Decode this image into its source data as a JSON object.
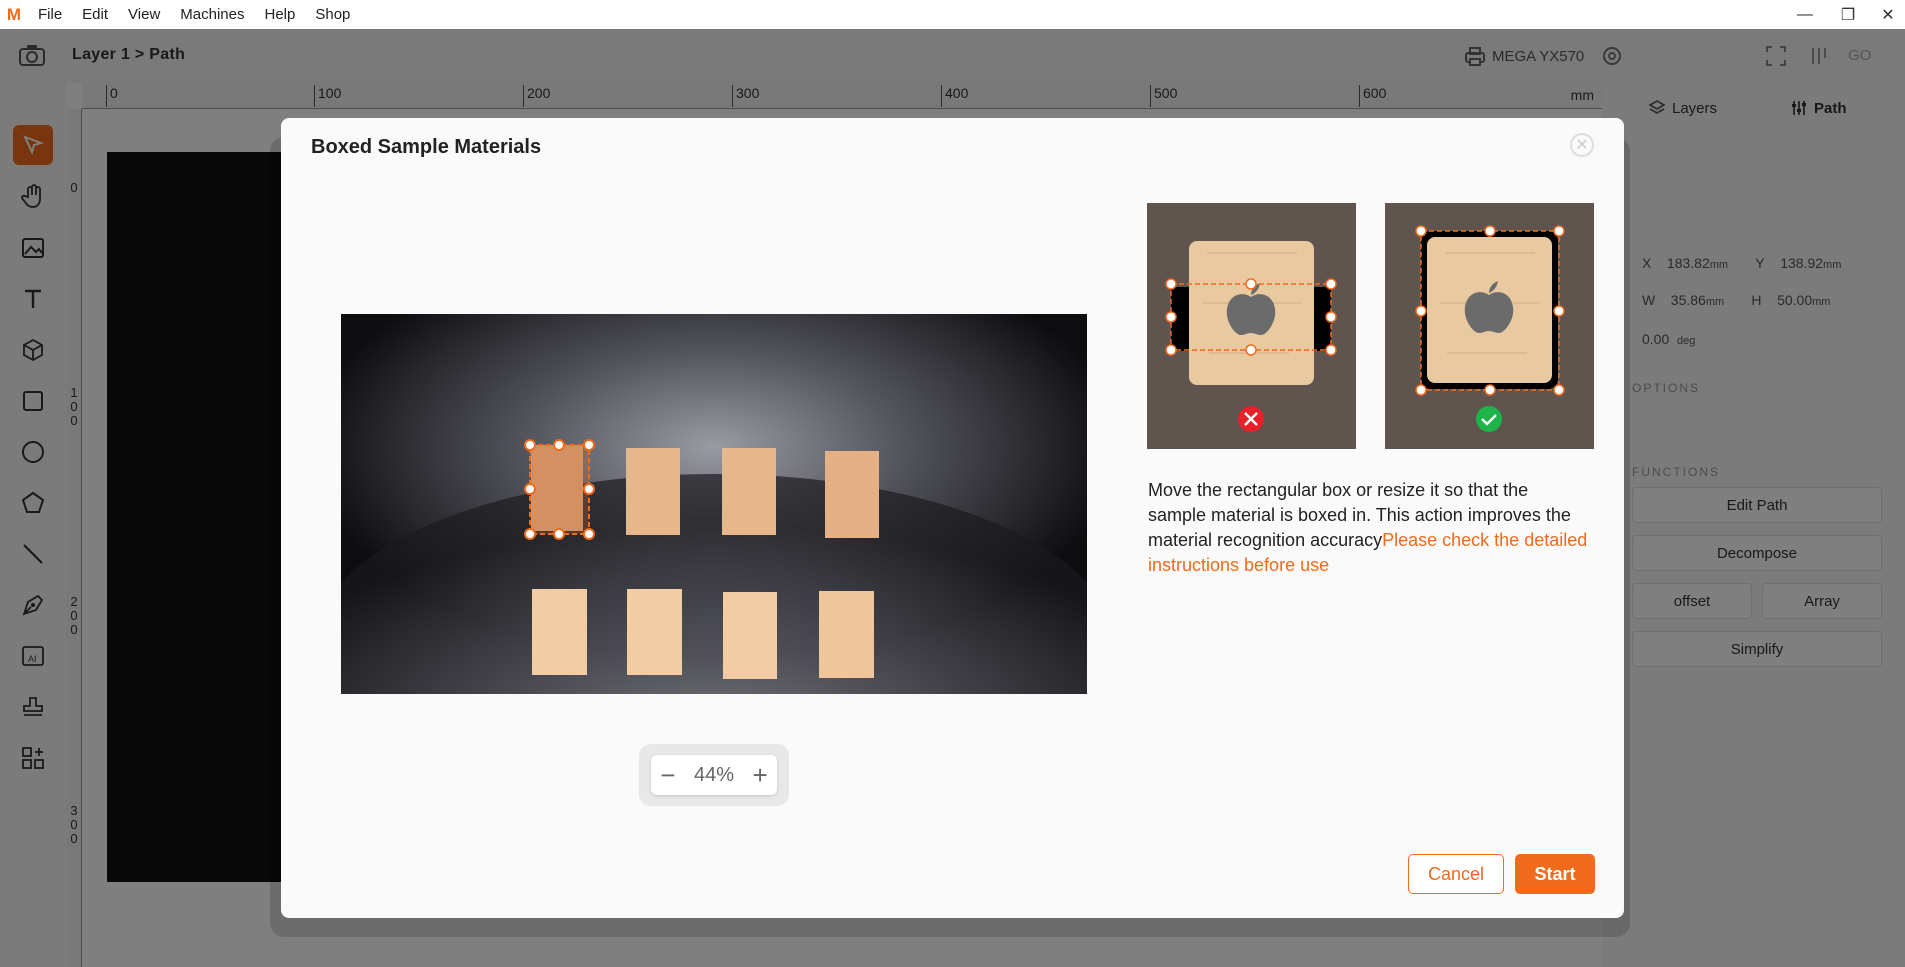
{
  "menu": {
    "logo": "M",
    "items": [
      "File",
      "Edit",
      "View",
      "Machines",
      "Help",
      "Shop"
    ],
    "window_controls": [
      "minimize-icon",
      "restore-icon",
      "close-icon"
    ]
  },
  "toolbar": {
    "breadcrumb": "Layer 1 > Path",
    "machine": "MEGA YX570",
    "go_label": "GO"
  },
  "ruler": {
    "top_ticks": [
      "0",
      "100",
      "200",
      "300",
      "400",
      "500",
      "600"
    ],
    "unit": "mm",
    "left_ticks": [
      [
        "0"
      ],
      [
        "1",
        "0",
        "0"
      ],
      [
        "2",
        "0",
        "0"
      ],
      [
        "3",
        "0",
        "0"
      ]
    ]
  },
  "right_panel": {
    "tabs": [
      "Layers",
      "Path"
    ],
    "x_label": "X",
    "x_value": "183.82",
    "x_unit": "mm",
    "y_label": "Y",
    "y_value": "138.92",
    "y_unit": "mm",
    "w_label": "W",
    "w_value": "35.86",
    "w_unit": "mm",
    "h_label": "H",
    "h_value": "50.00",
    "h_unit": "mm",
    "rotate_value": "0.00",
    "rotate_unit": "deg",
    "section_options": "OPTIONS",
    "section_functions": "FUNCTIONS",
    "edit_path": "Edit Path",
    "decompose": "Decompose",
    "offset": "offset",
    "array": "Array",
    "simplify": "Simplify"
  },
  "dialog": {
    "title": "Boxed Sample Materials",
    "zoom_value": "44%",
    "instruction_text": "Move the rectangular box or resize it so that the sample material is boxed in. This action improves the material recognition accuracy",
    "instruction_link": "Please check the detailed instructions before use",
    "cancel_label": "Cancel",
    "start_label": "Start",
    "examples": [
      {
        "status": "incorrect",
        "icon": "x-icon",
        "color": "#e8202a"
      },
      {
        "status": "correct",
        "icon": "check-icon",
        "color": "#1fb44a"
      }
    ]
  },
  "colors": {
    "accent": "#f26a1b",
    "material": "#eab98c"
  }
}
